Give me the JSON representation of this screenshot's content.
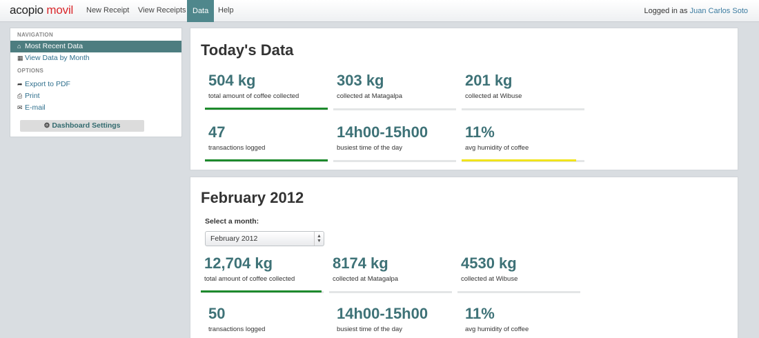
{
  "navbar": {
    "brand_part1": "acopio ",
    "brand_part2": "movil",
    "links": [
      "New Receipt",
      "View Receipts",
      "Data",
      "Help"
    ],
    "active_link": "Data",
    "login_prefix": "Logged in as ",
    "login_user": "Juan Carlos Soto"
  },
  "sidebar": {
    "nav_heading": "NAVIGATION",
    "nav_items": [
      "Most Recent Data",
      "View Data by Month"
    ],
    "options_heading": "OPTIONS",
    "option_items": [
      "Export to PDF",
      "Print",
      "E-mail"
    ],
    "settings_button": "Dashboard Settings"
  },
  "today": {
    "title": "Today's Data",
    "stats": [
      {
        "value": "504 kg",
        "label": "total amount of coffee collected",
        "status": "green"
      },
      {
        "value": "303 kg",
        "label": "collected at Matagalpa",
        "status": "none"
      },
      {
        "value": "201 kg",
        "label": "collected at Wibuse",
        "status": "none"
      },
      {
        "value": "47",
        "label": "transactions logged",
        "status": "green"
      },
      {
        "value": "14h00-15h00",
        "label": "busiest time of the day",
        "status": "none"
      },
      {
        "value": "11%",
        "label": "avg humidity of coffee",
        "status": "yellow"
      }
    ]
  },
  "month": {
    "title": "February 2012",
    "select_label": "Select a month:",
    "selected_month": "February 2012",
    "stats": [
      {
        "value": "12,704 kg",
        "label": "total amount of coffee collected",
        "status": "green"
      },
      {
        "value": "8174 kg",
        "label": "collected at Matagalpa",
        "status": "none"
      },
      {
        "value": "4530 kg",
        "label": "collected at Wibuse",
        "status": "none"
      },
      {
        "value": "50",
        "label": "transactions logged",
        "status": "none"
      },
      {
        "value": "14h00-15h00",
        "label": "busiest time of the day",
        "status": "none"
      },
      {
        "value": "11%",
        "label": "avg humidity of coffee",
        "status": "none"
      }
    ]
  },
  "colors": {
    "accent": "#4f878c",
    "value_text": "#3e7277",
    "status_green": "#1d8a2c",
    "status_yellow": "#f1e41c",
    "brand_red": "#d9262a"
  },
  "icons": {
    "most_recent": "home-icon",
    "by_month": "calendar-icon",
    "export": "share-arrow-icon",
    "print": "printer-icon",
    "email": "envelope-icon",
    "settings": "gear-icon"
  }
}
